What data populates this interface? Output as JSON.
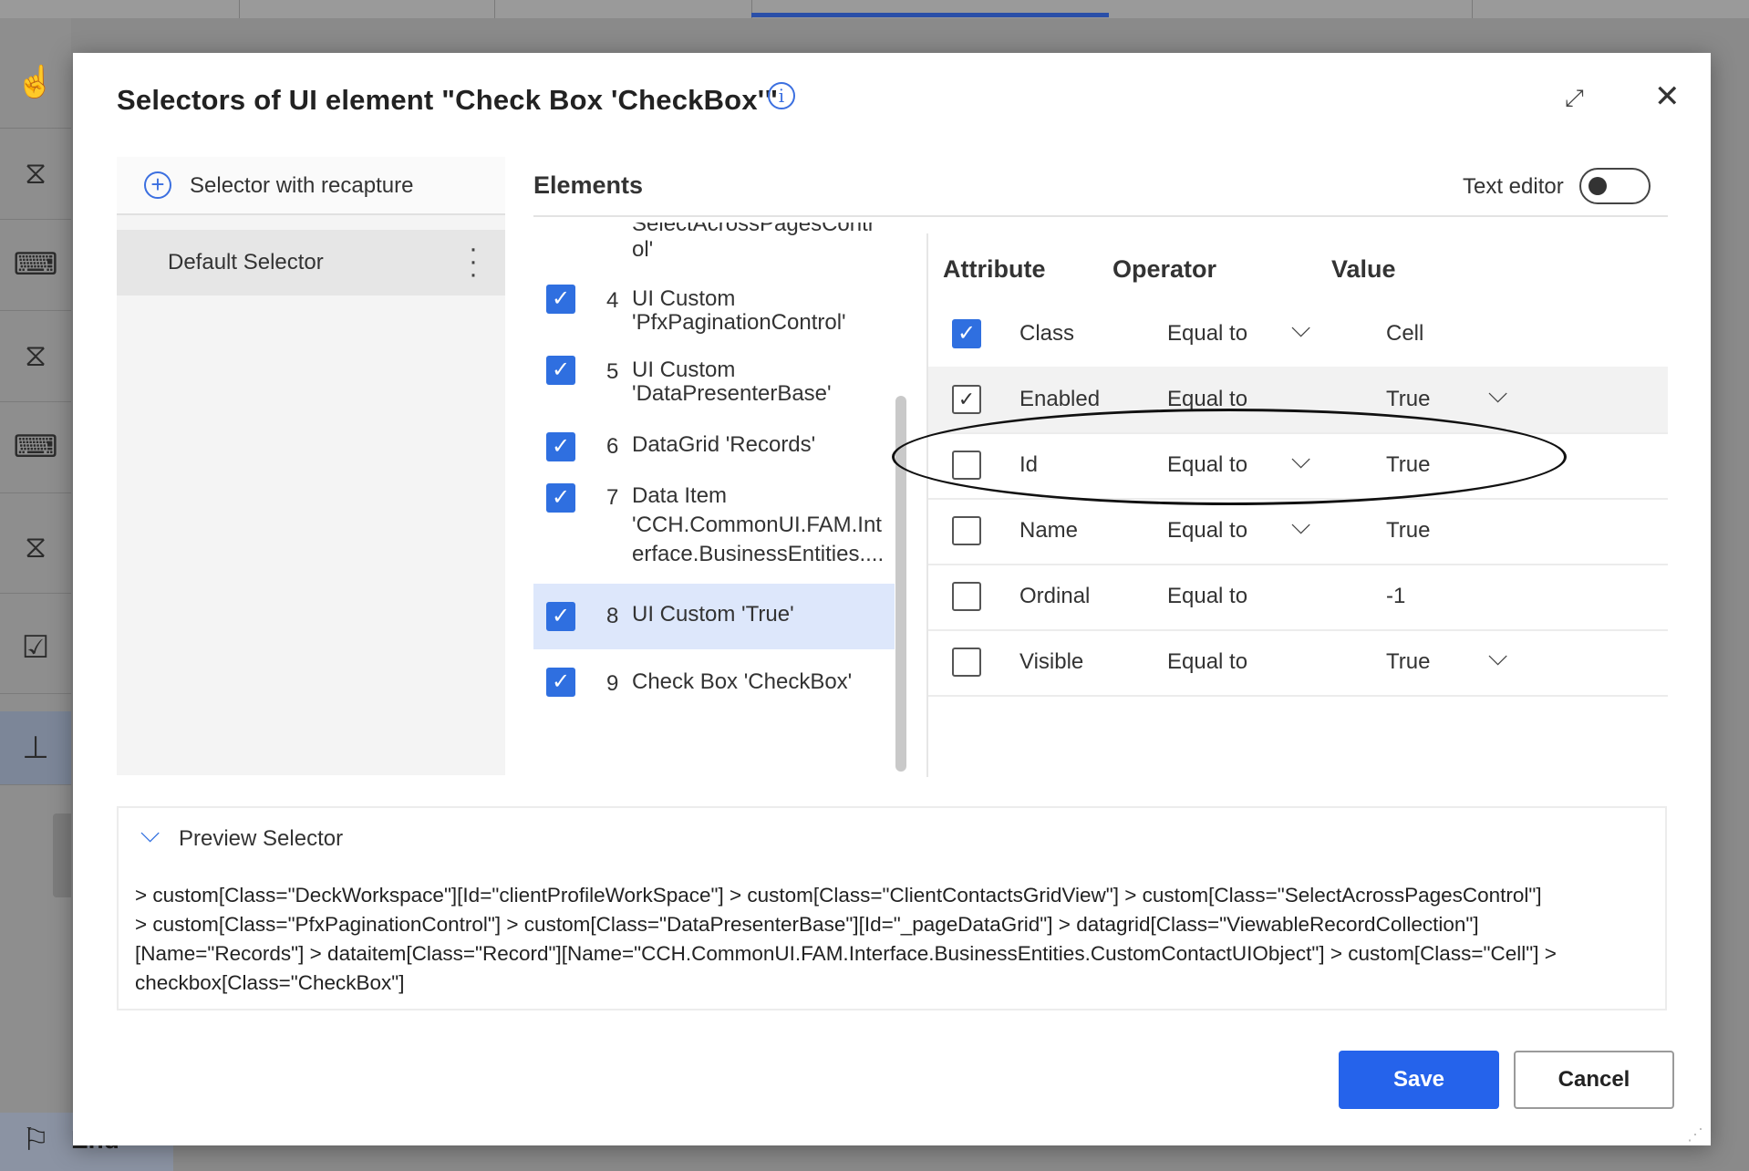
{
  "dialog": {
    "title": "Selectors of UI element \"Check Box 'CheckBox'\"",
    "info_icon": "info-icon",
    "expand_icon": "expand-icon",
    "close_icon": "close-icon"
  },
  "selectors_panel": {
    "recapture_label": "Selector with recapture",
    "default_selector_label": "Default Selector",
    "more_icon": "more-vertical-icon"
  },
  "elements": {
    "title": "Elements",
    "text_editor_label": "Text editor",
    "text_editor_on": false,
    "partial_top_line1": "SelectAcrossPagesContr",
    "partial_top_line2": "ol'",
    "items": [
      {
        "num": "4",
        "line1": "UI Custom",
        "line2": "'PfxPaginationControl'",
        "line3": "",
        "checked": true
      },
      {
        "num": "5",
        "line1": "UI Custom",
        "line2": "'DataPresenterBase'",
        "line3": "",
        "checked": true
      },
      {
        "num": "6",
        "line1": "DataGrid 'Records'",
        "line2": "",
        "line3": "",
        "checked": true
      },
      {
        "num": "7",
        "line1": "Data Item",
        "line2": "'CCH.CommonUI.FAM.Int",
        "line3": "erface.BusinessEntities....",
        "checked": true
      },
      {
        "num": "8",
        "line1": "UI Custom 'True'",
        "line2": "",
        "line3": "",
        "checked": true,
        "selected": true
      },
      {
        "num": "9",
        "line1": "Check Box 'CheckBox'",
        "line2": "",
        "line3": "",
        "checked": true
      }
    ]
  },
  "attributes": {
    "headers": {
      "attribute": "Attribute",
      "operator": "Operator",
      "value": "Value"
    },
    "rows": [
      {
        "name": "Class",
        "operator": "Equal to",
        "value": "Cell",
        "checked": true,
        "op_dropdown": true,
        "val_dropdown": false
      },
      {
        "name": "Enabled",
        "operator": "Equal to",
        "value": "True",
        "checked": true,
        "op_dropdown": false,
        "val_dropdown": true,
        "highlighted": true
      },
      {
        "name": "Id",
        "operator": "Equal to",
        "value": "True",
        "checked": false,
        "op_dropdown": true,
        "val_dropdown": false
      },
      {
        "name": "Name",
        "operator": "Equal to",
        "value": "True",
        "checked": false,
        "op_dropdown": true,
        "val_dropdown": false
      },
      {
        "name": "Ordinal",
        "operator": "Equal to",
        "value": "-1",
        "checked": false,
        "op_dropdown": false,
        "val_dropdown": false
      },
      {
        "name": "Visible",
        "operator": "Equal to",
        "value": "True",
        "checked": false,
        "op_dropdown": false,
        "val_dropdown": true
      }
    ]
  },
  "preview": {
    "label": "Preview Selector",
    "lines": [
      " > custom[Class=\"DeckWorkspace\"][Id=\"clientProfileWorkSpace\"] > custom[Class=\"ClientContactsGridView\"] > custom[Class=\"SelectAcrossPagesControl\"]",
      "> custom[Class=\"PfxPaginationControl\"] > custom[Class=\"DataPresenterBase\"][Id=\"_pageDataGrid\"] > datagrid[Class=\"ViewableRecordCollection\"]",
      "[Name=\"Records\"] > dataitem[Class=\"Record\"][Name=\"CCH.CommonUI.FAM.Interface.BusinessEntities.CustomContactUIObject\"] > custom[Class=\"Cell\"] >",
      "checkbox[Class=\"CheckBox\"]"
    ]
  },
  "buttons": {
    "save": "Save",
    "cancel": "Cancel"
  },
  "background": {
    "end_label": "End"
  },
  "colors": {
    "accent": "#2563eb",
    "checkbox": "#2f6fe0",
    "selected_row": "#dde7fb"
  }
}
